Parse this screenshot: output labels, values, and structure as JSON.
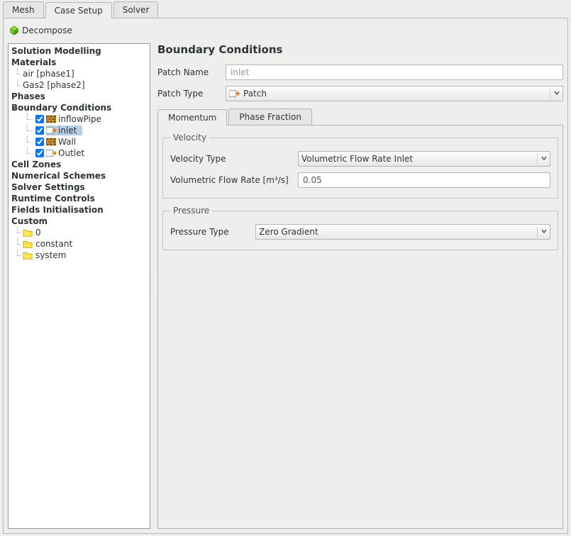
{
  "tabs": {
    "mesh": "Mesh",
    "case_setup": "Case Setup",
    "solver": "Solver"
  },
  "toolbar": {
    "decompose": "Decompose"
  },
  "tree": {
    "solution_modelling": "Solution Modelling",
    "materials": "Materials",
    "materials_items": [
      "air [phase1]",
      "Gas2 [phase2]"
    ],
    "phases": "Phases",
    "boundary_conditions": "Boundary Conditions",
    "bc_items": [
      {
        "label": "inflowPipe",
        "icon": "wall"
      },
      {
        "label": "inlet",
        "icon": "patch",
        "selected": true
      },
      {
        "label": "Wall",
        "icon": "wall"
      },
      {
        "label": "Outlet",
        "icon": "patch"
      }
    ],
    "cell_zones": "Cell Zones",
    "numerical_schemes": "Numerical Schemes",
    "solver_settings": "Solver Settings",
    "runtime_controls": "Runtime Controls",
    "fields_init": "Fields Initialisation",
    "custom": "Custom",
    "custom_items": [
      "0",
      "constant",
      "system"
    ]
  },
  "panel": {
    "title": "Boundary Conditions",
    "patch_name_label": "Patch Name",
    "patch_name_value": "inlet",
    "patch_type_label": "Patch Type",
    "patch_type_value": "Patch",
    "subtabs": {
      "momentum": "Momentum",
      "phase_fraction": "Phase Fraction"
    },
    "velocity": {
      "legend": "Velocity",
      "type_label": "Velocity Type",
      "type_value": "Volumetric Flow Rate Inlet",
      "rate_label": "Volumetric Flow Rate [m³/s]",
      "rate_value": "0.05"
    },
    "pressure": {
      "legend": "Pressure",
      "type_label": "Pressure Type",
      "type_value": "Zero Gradient"
    }
  }
}
